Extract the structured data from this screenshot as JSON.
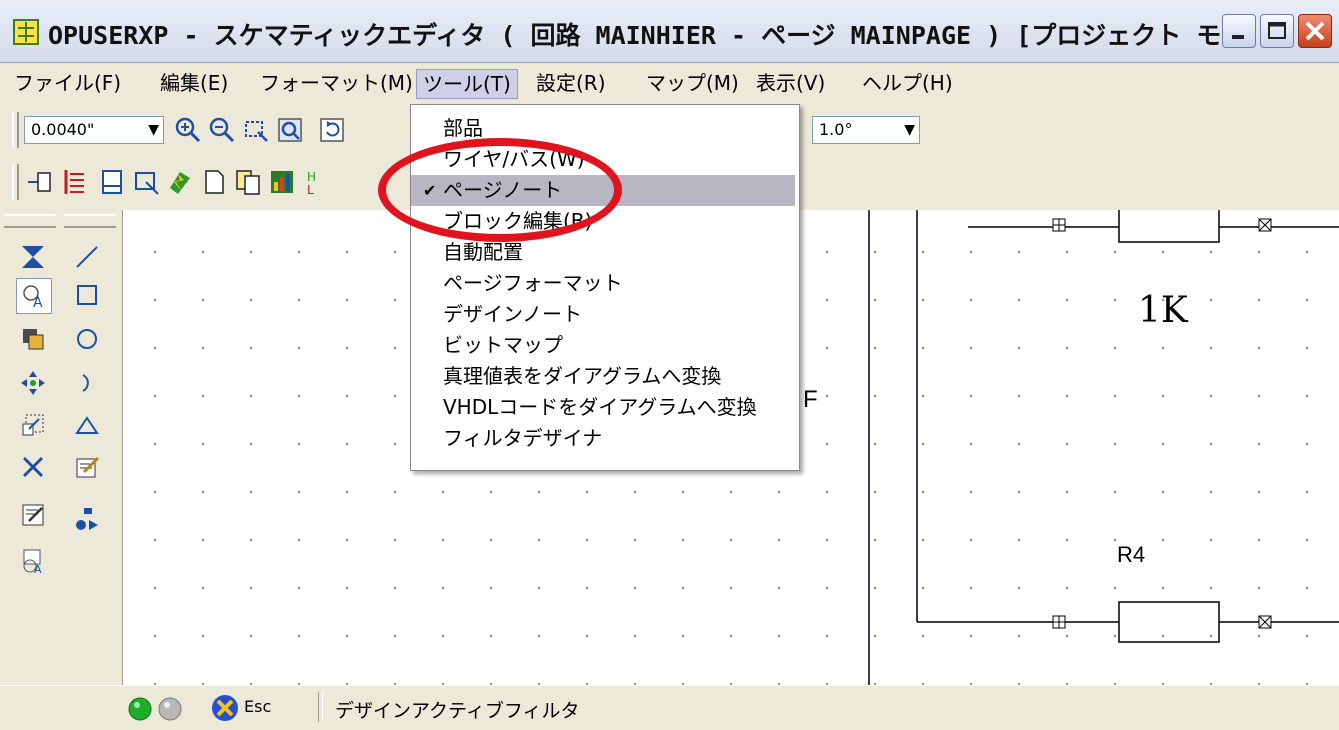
{
  "window": {
    "title": "OPUSERXP - スケマティックエディタ ( 回路 MAINHIER - ページ MAINPAGE ) [プロジェクト モー..."
  },
  "menubar": {
    "items": [
      {
        "label": "ファイル(F)"
      },
      {
        "label": "編集(E)"
      },
      {
        "label": "フォーマット(M)"
      },
      {
        "label": "ツール(T)"
      },
      {
        "label": "設定(R)"
      },
      {
        "label": "マップ(M)"
      },
      {
        "label": "表示(V)"
      },
      {
        "label": "ヘルプ(H)"
      }
    ]
  },
  "toolbar": {
    "grid_value": "0.0040\"",
    "angle_value": "1.0°"
  },
  "tools_menu": {
    "items": [
      {
        "label": "部品",
        "checked": false
      },
      {
        "label": "ワイヤ/バス(W)",
        "checked": false
      },
      {
        "label": "ページノート",
        "checked": true
      },
      {
        "label": "ブロック編集(B)",
        "checked": false
      },
      {
        "label": "自動配置",
        "checked": false
      },
      {
        "label": "ページフォーマット",
        "checked": false
      },
      {
        "label": "デザインノート",
        "checked": false
      },
      {
        "label": "ビットマップ",
        "checked": false
      },
      {
        "label": "真理値表をダイアグラムへ変換",
        "checked": false
      },
      {
        "label": "VHDLコードをダイアグラムへ変換",
        "checked": false
      },
      {
        "label": "フィルタデザイナ",
        "checked": false
      }
    ],
    "check_mark": "✔"
  },
  "schematic": {
    "resistor_value_label": "1K",
    "resistor_ref_label": "R4",
    "partial_text": "F"
  },
  "statusbar": {
    "esc_label": "Esc",
    "status_text": "デザインアクティブフィルタ"
  },
  "colors": {
    "highlight_oval": "#e0141e",
    "menu_checked_bg": "#b9b6c4"
  }
}
